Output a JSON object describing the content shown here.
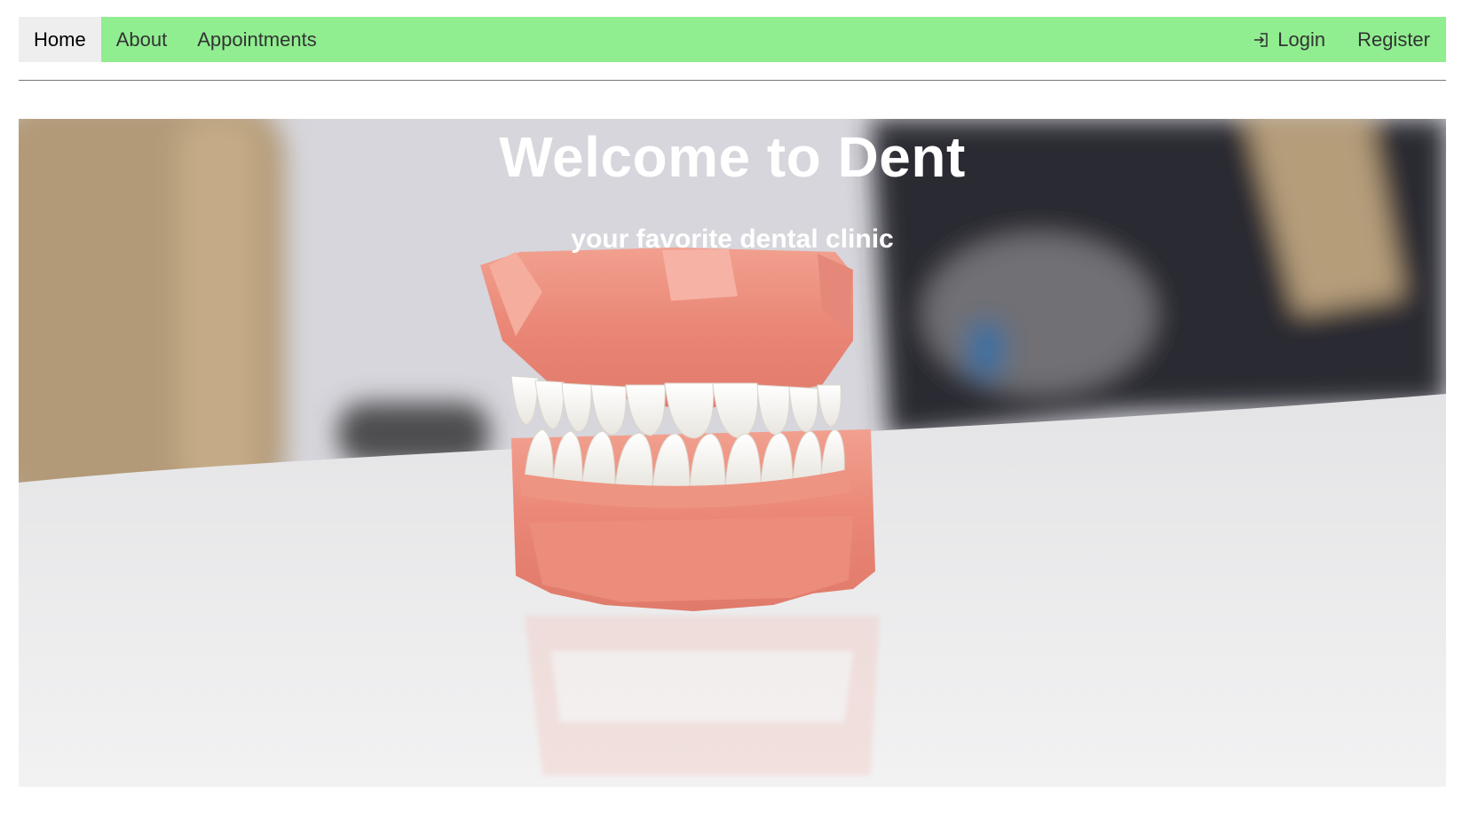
{
  "nav": {
    "left": [
      {
        "label": "Home",
        "active": true
      },
      {
        "label": "About",
        "active": false
      },
      {
        "label": "Appointments",
        "active": false
      }
    ],
    "right": {
      "login_label": "Login",
      "login_icon": "login-icon",
      "register_label": "Register"
    },
    "colors": {
      "bar": "#90ee90",
      "active_bg": "#eeeeee"
    }
  },
  "hero": {
    "title": "Welcome to Dent",
    "subtitle": "your favorite dental clinic",
    "image_subject": "dental-model-teeth-photo"
  }
}
